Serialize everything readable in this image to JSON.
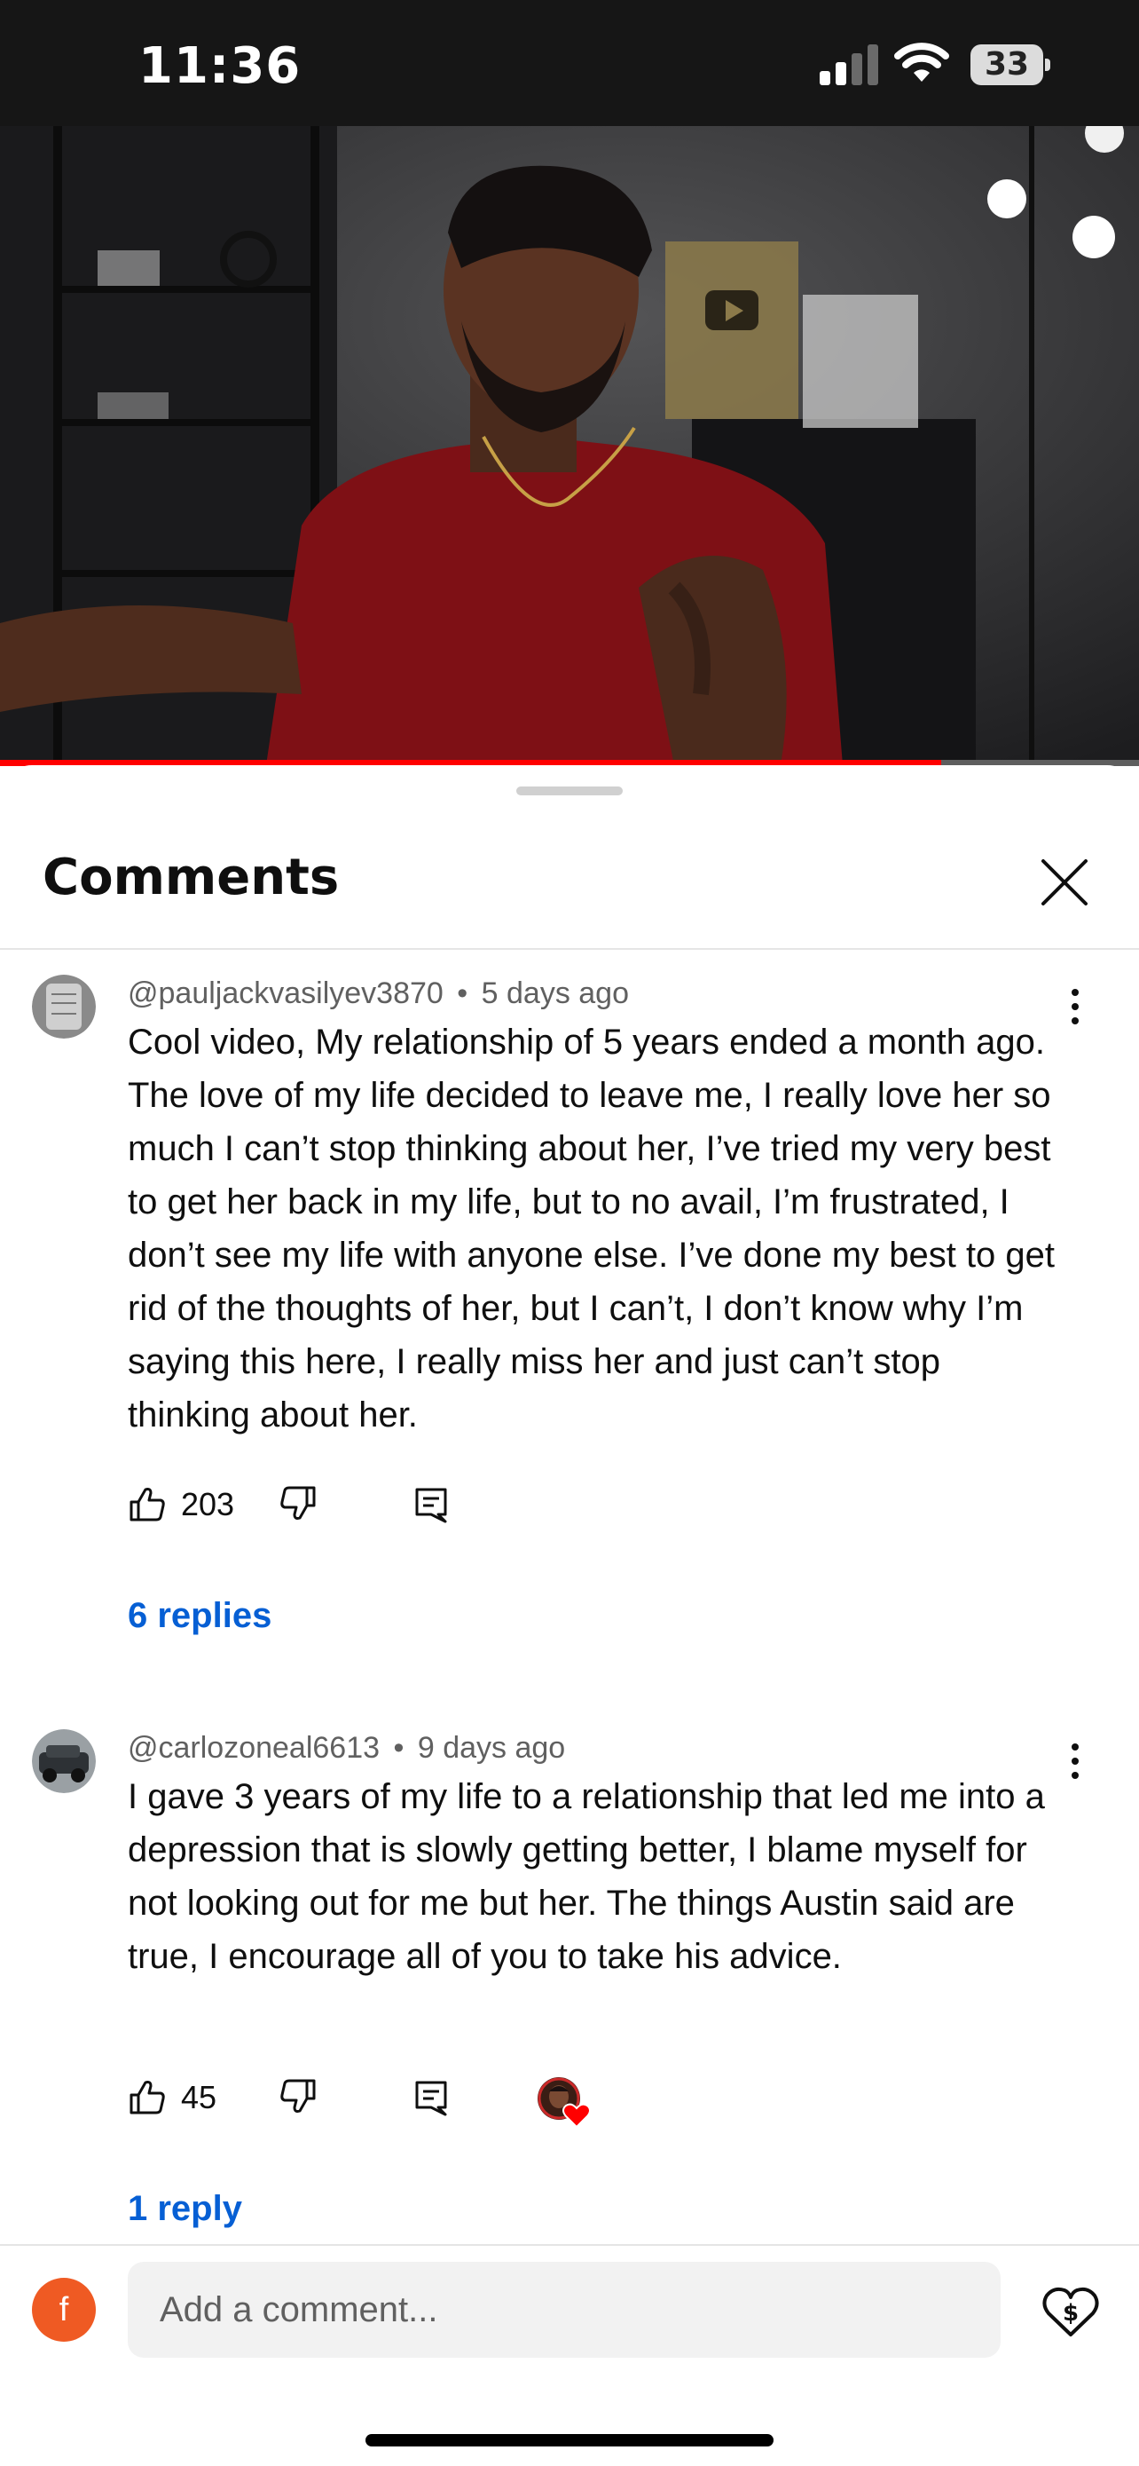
{
  "status_bar": {
    "time": "11:36",
    "battery": "33",
    "icons": [
      "cellular-signal-icon",
      "wifi-icon",
      "battery-icon"
    ]
  },
  "video": {
    "progress": 0.826,
    "progress_color": "#ff0000"
  },
  "comments_panel": {
    "title": "Comments",
    "comments": [
      {
        "author": "@pauljackvasilyev3870",
        "separator": "•",
        "time": "5 days ago",
        "text": "Cool video, My relationship of 5 years ended a month ago. The love of my life decided to leave me, I really love her so much I can’t stop thinking about her, I’ve tried my very best to get her back in my life, but to no avail, I’m frustrated, I don’t see my life with anyone else. I’ve done my best to get rid of the thoughts of her, but I can’t, I don’t know why I’m saying this here, I really miss her and just can’t stop thinking about her.",
        "likes": "203",
        "replies": "6 replies"
      },
      {
        "author": "@carlozoneal6613",
        "separator": "•",
        "time": "9 days ago",
        "text": "I gave 3 years of my life to a relationship that led me into a depression that is slowly getting better, I blame myself for not looking out for me but her.  The things Austin said are true, I encourage all of you to take his advice.",
        "likes": "45",
        "replies": "1 reply",
        "creator_hearted": true
      }
    ]
  },
  "composer": {
    "avatar_letter": "f",
    "avatar_color": "#ef5a23",
    "placeholder": "Add a comment..."
  },
  "colors": {
    "link": "#065fd4",
    "text": "#0f0f0f",
    "secondary": "#606060"
  }
}
